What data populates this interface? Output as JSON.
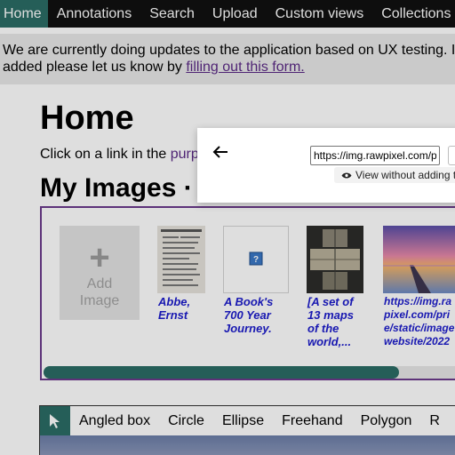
{
  "nav": {
    "items": [
      {
        "label": "Home",
        "active": true
      },
      {
        "label": "Annotations"
      },
      {
        "label": "Search"
      },
      {
        "label": "Upload"
      },
      {
        "label": "Custom views"
      },
      {
        "label": "Collections"
      }
    ]
  },
  "notice": {
    "line1": "We are currently doing updates to the application based on UX testing. I",
    "line2_prefix": "added please let us know by ",
    "link": "filling out this form."
  },
  "main": {
    "title": "Home",
    "intro_prefix": "Click on a link in the ",
    "intro_link": "purp",
    "section_title": "My Images",
    "section_suffix": "·"
  },
  "images": {
    "add_label_1": "Add",
    "add_label_2": "Image",
    "items": [
      {
        "caption_lines": [
          "Abbe,",
          "Ernst"
        ]
      },
      {
        "caption_lines": [
          "A Book's",
          "700 Year",
          "Journey."
        ]
      },
      {
        "caption_lines": [
          "[A set of",
          "13 maps",
          "of the",
          "world,..."
        ]
      },
      {
        "caption_lines": [
          "https://img.ra",
          "pixel.com/pri",
          "e/static/image",
          "website/2022"
        ]
      }
    ],
    "scroll_fraction": 0.84
  },
  "tools": {
    "items": [
      "Angled box",
      "Circle",
      "Ellipse",
      "Freehand",
      "Polygon",
      "R"
    ]
  },
  "modal": {
    "url_value": "https://img.rawpixel.com/pi",
    "view_button": "View without adding t"
  },
  "colors": {
    "accent": "#2b6d66",
    "link_purple": "#5b2a86",
    "caption_blue": "#1c1ccc",
    "nav_bg": "#111111"
  }
}
